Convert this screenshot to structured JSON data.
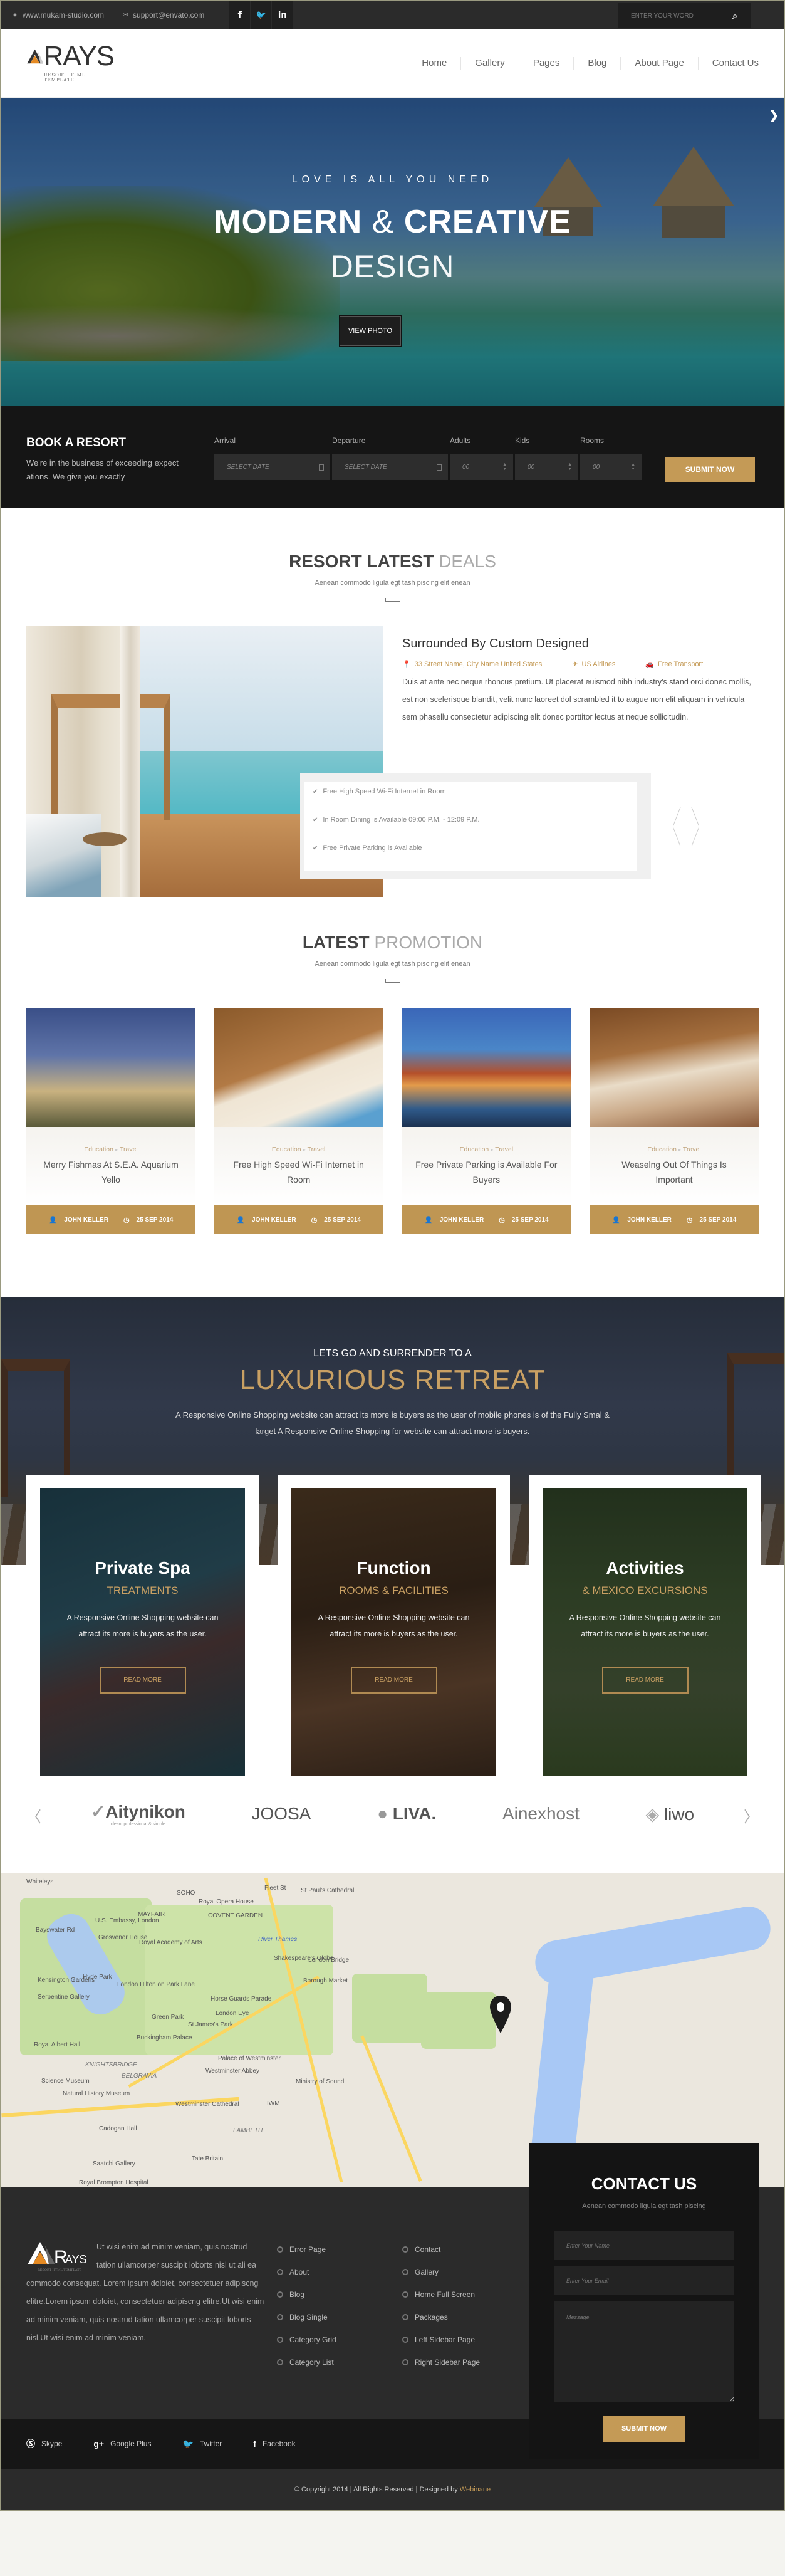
{
  "topbar": {
    "website": "www.mukam-studio.com",
    "email": "support@envato.com",
    "socials": [
      {
        "icon": "facebook-icon",
        "glyph": "f"
      },
      {
        "icon": "twitter-icon",
        "glyph": "t"
      },
      {
        "icon": "linkedin-icon",
        "glyph": "in"
      }
    ],
    "search_placeholder": "ENTER YOUR WORD"
  },
  "header": {
    "logo_name": "RAYS",
    "logo_tagline": "RESORT HTML TEMPLATE",
    "nav": [
      "Home",
      "Gallery",
      "Pages",
      "Blog",
      "About Page",
      "Contact Us"
    ]
  },
  "hero": {
    "kicker": "LOVE IS ALL YOU NEED",
    "title_bold1": "MODERN",
    "title_amp": " & ",
    "title_bold2": "CREATIVE",
    "title_line2": "DESIGN",
    "button": "VIEW PHOTO"
  },
  "booking": {
    "title": "BOOK A RESORT",
    "description": "We're in the business of exceeding expect ations. We give you exactly",
    "fields": [
      {
        "label": "Arrival",
        "placeholder": "SELECT DATE"
      },
      {
        "label": "Departure",
        "placeholder": "SELECT DATE"
      },
      {
        "label": "Adults",
        "placeholder": "00"
      },
      {
        "label": "Kids",
        "placeholder": "00"
      },
      {
        "label": "Rooms",
        "placeholder": "00"
      }
    ],
    "submit": "SUBMIT NOW"
  },
  "deals": {
    "title_bold": "RESORT LATEST",
    "title_light": "DEALS",
    "subtitle": "Aenean commodo ligula egt tash piscing elit enean",
    "item_title": "Surrounded By Custom Designed",
    "address": "33 Street Name, City Name United States",
    "airline": "US Airlines",
    "transport": "Free Transport",
    "body": "Duis at ante nec neque rhoncus pretium. Ut placerat euismod nibh industry's stand orci donec mollis, est non scelerisque blandit, velit nunc laoreet dol scrambled it to augue non elit aliquam in vehicula sem phasellu consectetur adipiscing elit donec porttitor lectus at neque sollicitudin.",
    "features": [
      "Free High Speed Wi-Fi Internet in Room",
      "In Room Dining is Available 09:00 P.M. - 12:09 P.M.",
      "Free Private Parking is Available"
    ]
  },
  "promotion": {
    "title_bold": "LATEST",
    "title_light": "PROMOTION",
    "subtitle": "Aenean commodo ligula egt tash piscing elit enean",
    "cards": [
      {
        "cat1": "Education",
        "cat2": "Travel",
        "title": "Merry Fishmas At S.E.A. Aquarium Yello",
        "author": "JOHN KELLER",
        "date": "25 SEP 2014"
      },
      {
        "cat1": "Education",
        "cat2": "Travel",
        "title": "Free High Speed Wi-Fi Internet in Room",
        "author": "JOHN KELLER",
        "date": "25 SEP 2014"
      },
      {
        "cat1": "Education",
        "cat2": "Travel",
        "title": "Free Private Parking is Available For Buyers",
        "author": "JOHN KELLER",
        "date": "25 SEP 2014"
      },
      {
        "cat1": "Education",
        "cat2": "Travel",
        "title": "Weaselng Out Of Things Is Important",
        "author": "JOHN KELLER",
        "date": "25 SEP 2014"
      }
    ]
  },
  "retreat": {
    "kicker": "LETS GO AND SURRENDER TO A",
    "title": "LUXURIOUS RETREAT",
    "body": "A Responsive Online Shopping website can attract its more is buyers as the user of mobile phones is of the Fully Smal & larget A Responsive Online Shopping for website can attract more is buyers.",
    "cards": [
      {
        "title": "Private Spa",
        "subtitle": "TREATMENTS",
        "body": "A Responsive Online Shopping website can attract its more is buyers as the user.",
        "button": "READ MORE"
      },
      {
        "title": "Function",
        "subtitle": "ROOMS & FACILITIES",
        "body": "A Responsive Online Shopping website can attract its more is buyers as the user.",
        "button": "READ MORE"
      },
      {
        "title": "Activities",
        "subtitle": "& MEXICO EXCURSIONS",
        "body": "A Responsive Online Shopping website can attract its more is buyers as the user.",
        "button": "READ MORE"
      }
    ]
  },
  "partners": [
    {
      "name": "Aitynikon",
      "tagline": "clean, professional & simple"
    },
    {
      "name": "JOOSA",
      "tagline": ""
    },
    {
      "name": "LIVA.",
      "tagline": ""
    },
    {
      "name": "Ainexhost",
      "tagline": ""
    },
    {
      "name": "liwo",
      "tagline": ""
    }
  ],
  "map": {
    "labels": [
      "Whiteleys",
      "Bayswater Rd",
      "Hyde Park",
      "Kensington Gardens",
      "Serpentine Gallery",
      "U.S. Embassy, London",
      "Grosvenor House",
      "MAYFAIR",
      "SOHO",
      "Royal Opera House",
      "COVENT GARDEN",
      "Royal Academy of Arts",
      "London Hilton on Park Lane",
      "Green Park",
      "St James's Park",
      "Buckingham Palace",
      "Horse Guards Parade",
      "London Eye",
      "River Thames",
      "Shakespeare's Globe",
      "London Bridge",
      "Borough Market",
      "Palace of Westminster",
      "Westminster Abbey",
      "KNIGHTSBRIDGE",
      "BELGRAVIA",
      "Royal Albert Hall",
      "Science Museum",
      "Natural History Museum",
      "Westminster Cathedral",
      "Cadogan Hall",
      "Saatchi Gallery",
      "Royal Brompton Hospital",
      "Tate Britain",
      "LAMBETH",
      "IWM",
      "Ministry of Sound",
      "St Paul's Cathedral",
      "Fleet St"
    ]
  },
  "footer": {
    "about": "Ut wisi enim ad minim veniam, quis nostrud tation ullamcorper suscipit loborts nisl ut ali ea commodo consequat. Lorem ipsum doloiet, consectetuer adipiscng elitre.Lorem ipsum doloiet, consectetuer adipiscng elitre.Ut wisi enim ad minim veniam, quis nostrud tation ullamcorper suscipit loborts nisl.Ut wisi enim ad minim veniam.",
    "links_col1": [
      "Error Page",
      "About",
      "Blog",
      "Blog Single",
      "Category Grid",
      "Category List"
    ],
    "links_col2": [
      "Contact",
      "Gallery",
      "Home Full Screen",
      "Packages",
      "Left Sidebar Page",
      "Right Sidebar Page"
    ],
    "contact": {
      "title": "CONTACT US",
      "subtitle": "Aenean commodo ligula egt tash piscing",
      "name_placeholder": "Enter Your Name",
      "email_placeholder": "Enter Your Email",
      "message_placeholder": "Message",
      "submit": "SUBMIT NOW"
    },
    "social": [
      "Skype",
      "Google Plus",
      "Twitter",
      "Facebook"
    ],
    "copyright": "© Copyright 2014 | All Rights Reserved | Designed by ",
    "designer": "Webinane"
  },
  "colors": {
    "accent": "#c49a56",
    "dark": "#2b2b2b",
    "darker": "#151515"
  }
}
